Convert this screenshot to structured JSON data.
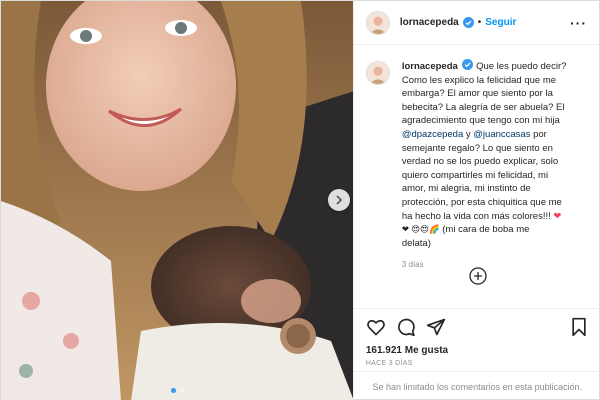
{
  "post": {
    "username": "lornacepeda",
    "separator": "•",
    "follow_label": "Seguir",
    "more_label": "···",
    "caption_lines": [
      "Que les puedo decir?",
      "Como les explico la felicidad que me",
      "embarga? El amor que siento por la",
      "bebecita? La alegría de ser abuela? El",
      "agradecimiento que tengo con mi hija"
    ],
    "mention_1": "@dpazcepeda",
    "mention_joiner": " y ",
    "mention_2": "@juanccasas",
    "mention_tail": " por",
    "caption_lines_2": [
      "semejante regalo? Lo que siento en",
      "verdad no se los puedo explicar, solo",
      "quiero compartirles mi felicidad, mi",
      "amor, mi alegria, mi instinto de",
      "protección, por esta chiquitica que me",
      "ha hecho la vida con más colores!!!"
    ],
    "emoji_line": "❤ 😍😍🌈",
    "emoji_tail": " (mi cara de boba me",
    "caption_end": "delata)",
    "time_ago": "3 días",
    "likes": "161.921 Me gusta",
    "posted": "HACE 3 DÍAS",
    "comments_notice": "Se han limitado los comentarios en esta publicación."
  },
  "icons": {
    "verified": "verified-badge",
    "like": "heart-outline",
    "comment": "speech-bubble",
    "share": "paper-plane",
    "save": "bookmark",
    "load_more": "plus-circle",
    "next": "chevron-right"
  },
  "colors": {
    "link_blue": "#0095f6",
    "mention_blue": "#00376b",
    "muted": "#8e8e8e",
    "heart_red": "#ed4956"
  },
  "carousel": {
    "slides": 2,
    "active": 1
  }
}
